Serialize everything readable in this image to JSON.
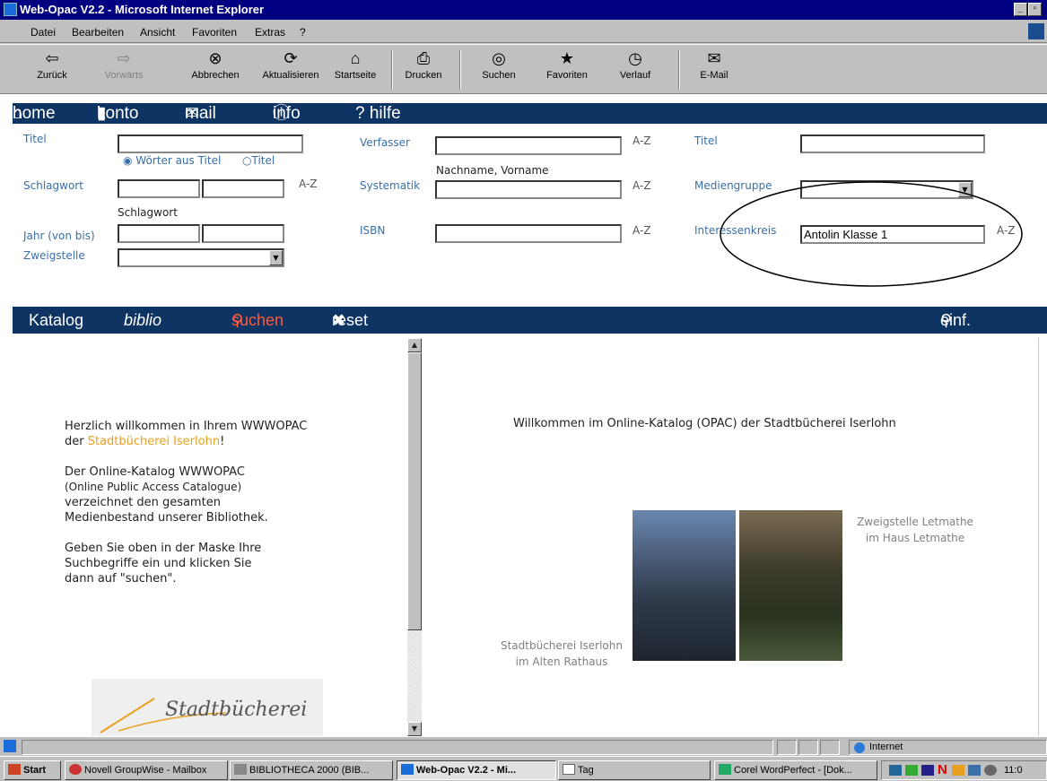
{
  "window": {
    "title": "Web-Opac V2.2 - Microsoft Internet Explorer"
  },
  "menu": [
    "Datei",
    "Bearbeiten",
    "Ansicht",
    "Favoriten",
    "Extras",
    "?"
  ],
  "toolbar": {
    "back": "Zurück",
    "forward": "Vorwärts",
    "stop": "Abbrechen",
    "refresh": "Aktualisieren",
    "home": "Startseite",
    "print": "Drucken",
    "search": "Suchen",
    "favorites": "Favoriten",
    "history": "Verlauf",
    "mail": "E-Mail"
  },
  "nav": {
    "home": "home",
    "konto": "konto",
    "mail": "mail",
    "info": "info",
    "hilfe": "? hilfe"
  },
  "form": {
    "titel_label": "Titel",
    "schlagwort_label": "Schlagwort",
    "jahr_label": "Jahr (von bis)",
    "zweigstelle_label": "Zweigstelle",
    "radio_woerter": "Wörter aus Titel",
    "radio_titel": "Titel",
    "schlagwort_hint": "Schlagwort",
    "verfasser_label": "Verfasser",
    "verfasser_hint": "Nachname, Vorname",
    "systematik_label": "Systematik",
    "isbn_label": "ISBN",
    "titel2_label": "Titel",
    "mediengruppe_label": "Mediengruppe",
    "interessenkreis_label": "Interessenkreis",
    "interessenkreis_value": "Antolin Klasse 1",
    "az": "A-Z"
  },
  "bar2": {
    "katalog": "Katalog",
    "biblio": "biblio",
    "suchen": "suchen",
    "reset": "reset",
    "einf": "einf. suche"
  },
  "left": {
    "p1a": "Herzlich willkommen in Ihrem WWWOPAC",
    "p1b_pre": "der ",
    "p1b_link": "Stadtbücherei Iserlohn",
    "p1b_post": "!",
    "p2a": "Der Online-Katalog WWWOPAC",
    "p2b": "(Online Public Access Catalogue)",
    "p2c": "verzeichnet den gesamten",
    "p2d": "Medienbestand unserer Bibliothek.",
    "p3a": "Geben Sie oben in der Maske Ihre",
    "p3b": "Suchbegriffe ein und klicken Sie",
    "p3c": "dann auf \"suchen\".",
    "logo": "Stadtbücherei"
  },
  "right": {
    "welcome": "Willkommen im Online-Katalog (OPAC) der Stadtbücherei Iserlohn",
    "cap_left1": "Stadtbücherei Iserlohn",
    "cap_left2": "im Alten Rathaus",
    "cap_right1": "Zweigstelle Letmathe",
    "cap_right2": "im Haus Letmathe"
  },
  "status": {
    "zone": "Internet"
  },
  "taskbar": {
    "start": "Start",
    "t1": "Novell GroupWise - Mailbox",
    "t2": "BIBLIOTHECA 2000 (BIB...",
    "t3": "Web-Opac V2.2 - Mi...",
    "t4": "Tag",
    "t5": "Corel WordPerfect - [Dok...",
    "clock": "11:0"
  },
  "colors": {
    "nav": "#0d3463",
    "label": "#3a6fa8",
    "accent": "#e8a020",
    "suchen": "#ff5a3c"
  }
}
